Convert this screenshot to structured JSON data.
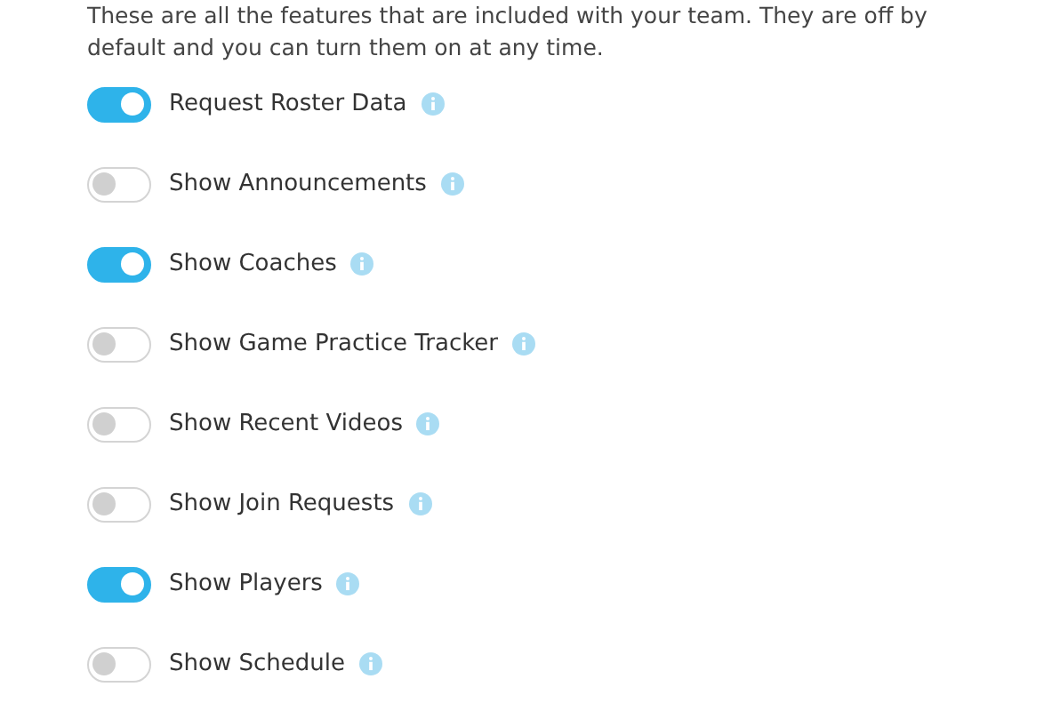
{
  "description": "These are all the features that are included with your team. They are off by default and you can turn them on at any time.",
  "features": [
    {
      "label": "Request Roster Data",
      "on": true
    },
    {
      "label": "Show Announcements",
      "on": false
    },
    {
      "label": "Show Coaches",
      "on": true
    },
    {
      "label": "Show Game Practice Tracker",
      "on": false
    },
    {
      "label": "Show Recent Videos",
      "on": false
    },
    {
      "label": "Show Join Requests",
      "on": false
    },
    {
      "label": "Show Players",
      "on": true
    },
    {
      "label": "Show Schedule",
      "on": false
    }
  ]
}
